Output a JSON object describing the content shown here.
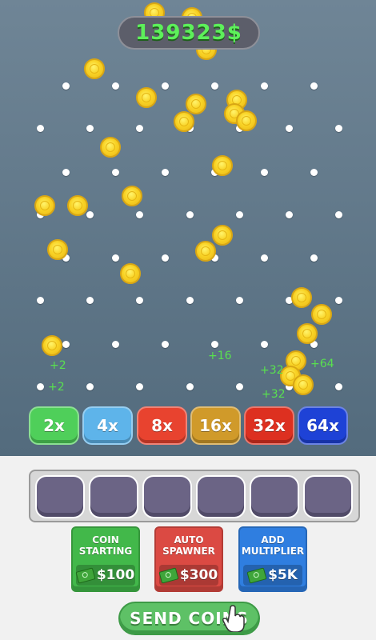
{
  "balance": "139323$",
  "multipliers": [
    {
      "label": "2x",
      "color": "#4fcf5a"
    },
    {
      "label": "4x",
      "color": "#5eb4ea"
    },
    {
      "label": "8x",
      "color": "#e8432f"
    },
    {
      "label": "16x",
      "color": "#d09a2a"
    },
    {
      "label": "32x",
      "color": "#dd3020"
    },
    {
      "label": "64x",
      "color": "#1e42d6"
    }
  ],
  "floating_labels": [
    "+16",
    "+64",
    "+32",
    "+32",
    "+2",
    "+2"
  ],
  "coin_slots": 6,
  "upgrades": [
    {
      "title": "COIN STARTING",
      "price": "$100",
      "color": "#42b84a",
      "icon": "cash-icon"
    },
    {
      "title": "AUTO SPAWNER",
      "price": "$300",
      "color": "#db4a43",
      "icon": "cash-icon"
    },
    {
      "title": "ADD MULTIPLIER",
      "price": "$5K",
      "color": "#2f7ee0",
      "icon": "cash-icon"
    }
  ],
  "send_button": "SEND COINS",
  "colors": {
    "accent": "#5df05a",
    "board": "#627a8c"
  }
}
